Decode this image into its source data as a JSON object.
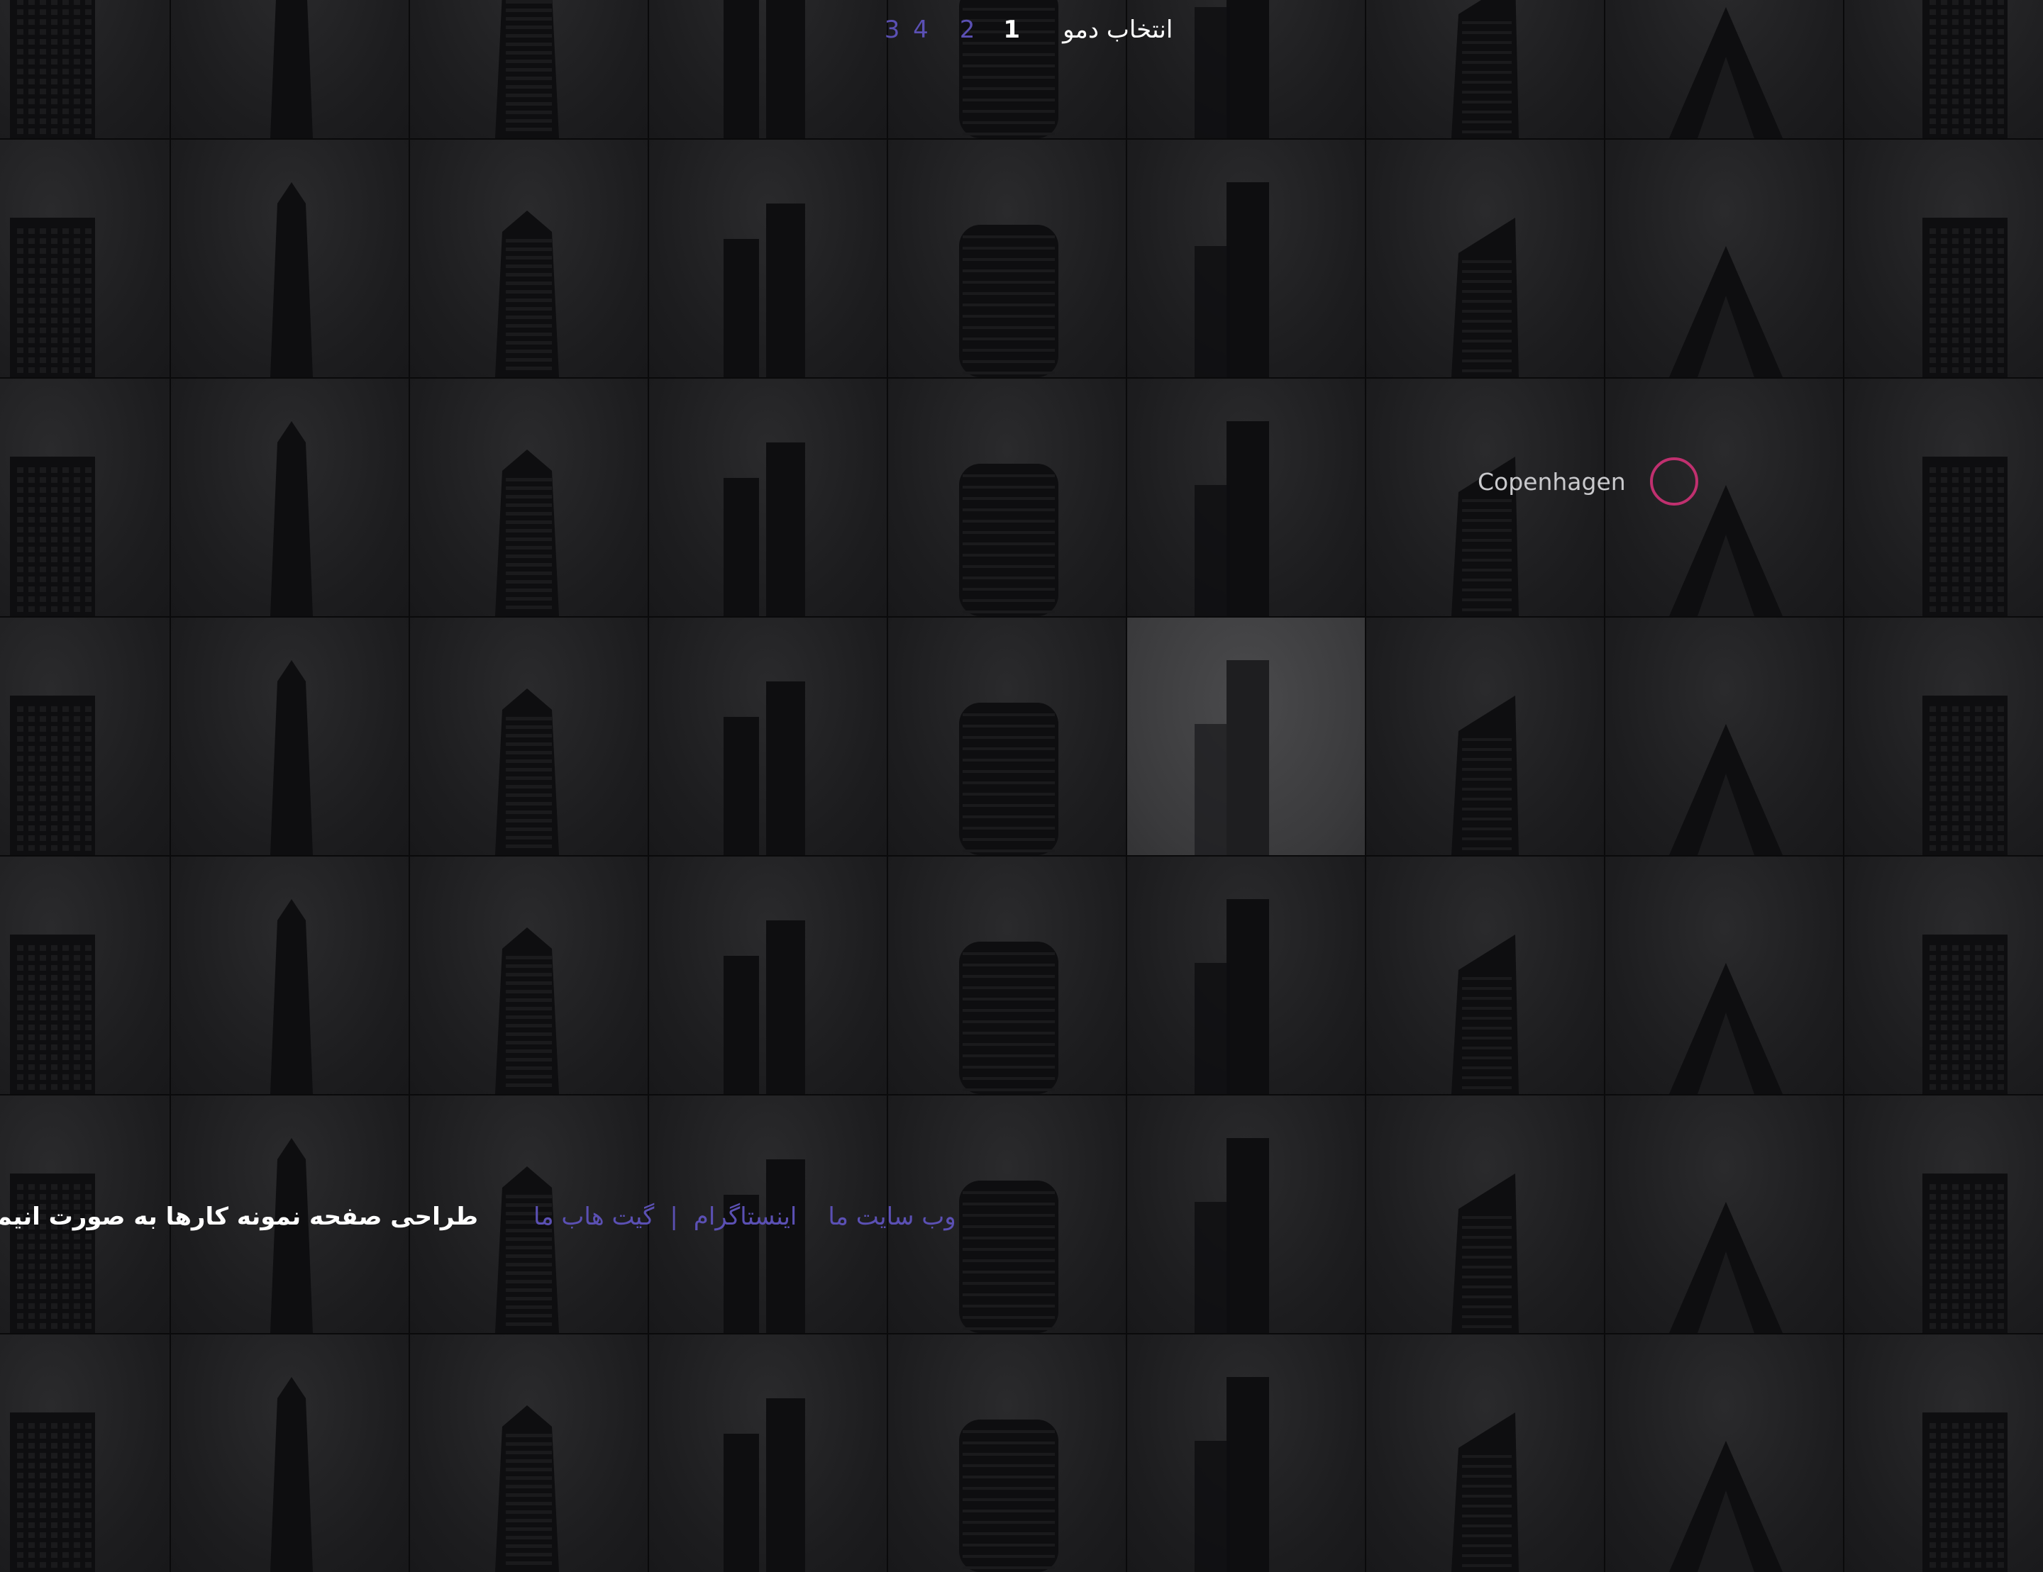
{
  "top_nav": {
    "title": "انتخاب دمو",
    "pages": [
      {
        "label": "1",
        "current": true
      },
      {
        "label": "2",
        "current": false
      },
      {
        "label": "4 3",
        "current": false
      }
    ]
  },
  "hover": {
    "label": "Copenhagen"
  },
  "footer": {
    "title": "طراحی صفحه نمونه کارها به صورت انیمیشنی",
    "links": [
      {
        "label": "گیت هاب ما"
      },
      {
        "label": "اینستاگرام"
      },
      {
        "label": "وب سایت ما"
      }
    ]
  },
  "colors": {
    "background": "#111112",
    "tile": "#1c1c1e",
    "tile_active": "#3a3a3c",
    "link": "#5b50b4",
    "cursor_ring": "#c0306f"
  },
  "grid": {
    "columns": 9,
    "rows": 7,
    "active_tile": 32,
    "tile_building_icons": [
      "building-icon",
      "building-icon",
      "building-icon",
      "building-icon",
      "building-icon",
      "building-icon",
      "building-icon",
      "building-icon",
      "building-icon",
      "building-icon",
      "building-icon",
      "building-icon",
      "building-icon",
      "building-icon",
      "building-icon",
      "building-icon",
      "building-icon",
      "building-icon",
      "building-icon",
      "building-icon",
      "building-icon",
      "building-icon",
      "building-icon",
      "building-icon",
      "building-icon",
      "building-icon",
      "building-icon",
      "building-icon",
      "building-icon",
      "building-icon",
      "building-icon",
      "building-icon",
      "building-icon",
      "building-icon",
      "building-icon",
      "building-icon",
      "building-icon",
      "building-icon",
      "building-icon",
      "building-icon",
      "building-icon",
      "building-icon",
      "building-icon",
      "building-icon",
      "building-icon",
      "building-icon",
      "building-icon",
      "building-icon",
      "building-icon",
      "building-icon",
      "building-icon",
      "building-icon",
      "building-icon",
      "building-icon",
      "building-icon",
      "building-icon",
      "building-icon",
      "building-icon",
      "building-icon",
      "building-icon",
      "building-icon",
      "building-icon",
      "building-icon"
    ]
  }
}
